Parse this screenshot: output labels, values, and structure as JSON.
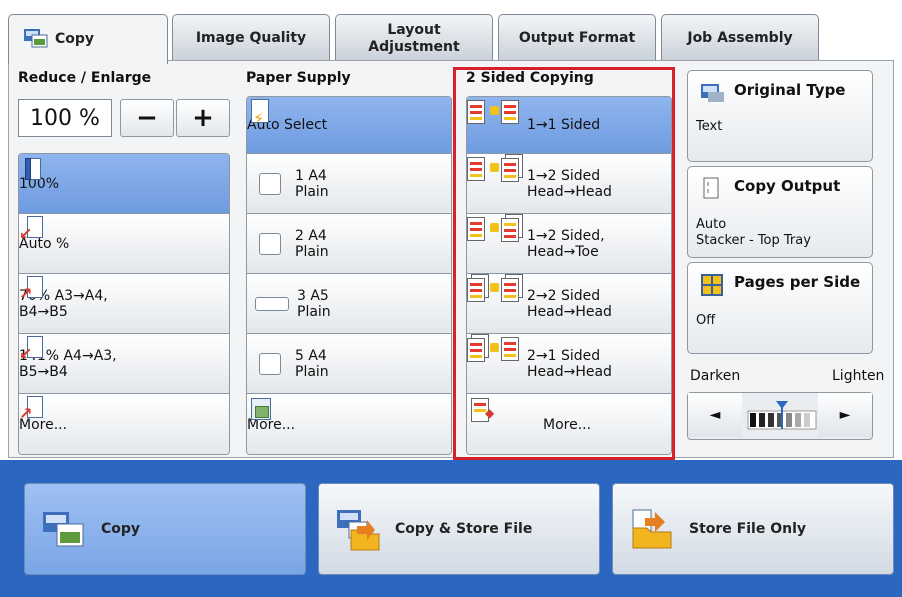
{
  "tabs": [
    {
      "label": "Copy",
      "active": true
    },
    {
      "label": "Image Quality"
    },
    {
      "label": "Layout Adjustment",
      "line1": "Layout",
      "line2": "Adjustment"
    },
    {
      "label": "Output Format"
    },
    {
      "label": "Job Assembly"
    }
  ],
  "reduce_enlarge": {
    "title": "Reduce / Enlarge",
    "value": "100 %",
    "minus": "−",
    "plus": "+",
    "options": [
      {
        "label": "100%",
        "selected": true
      },
      {
        "label": "Auto %"
      },
      {
        "label_line1": "70% A3→A4,",
        "label_line2": "B4→B5"
      },
      {
        "label_line1": "141% A4→A3,",
        "label_line2": "B5→B4"
      },
      {
        "label": "More..."
      }
    ]
  },
  "paper_supply": {
    "title": "Paper Supply",
    "options": [
      {
        "label": "Auto Select",
        "selected": true
      },
      {
        "line1": "1 A4",
        "line2": "Plain"
      },
      {
        "line1": "2 A4",
        "line2": "Plain"
      },
      {
        "line1": "3 A5",
        "line2": "Plain"
      },
      {
        "line1": "5 A4",
        "line2": "Plain"
      },
      {
        "label": "More..."
      }
    ]
  },
  "two_sided": {
    "title": "2 Sided Copying",
    "options": [
      {
        "line1": "1→1 Sided",
        "line2": "",
        "selected": true
      },
      {
        "line1": "1→2 Sided",
        "line2": "Head→Head"
      },
      {
        "line1": "1→2 Sided,",
        "line2": "Head→Toe"
      },
      {
        "line1": "2→2 Sided",
        "line2": "Head→Head"
      },
      {
        "line1": "2→1 Sided",
        "line2": "Head→Head"
      },
      {
        "line1": "More...",
        "line2": ""
      }
    ]
  },
  "original_type": {
    "title": "Original Type",
    "value": "Text"
  },
  "copy_output": {
    "title": "Copy Output",
    "value_line1": "Auto",
    "value_line2": "Stacker - Top Tray"
  },
  "pages_per_side": {
    "title": "Pages per Side",
    "value": "Off"
  },
  "density": {
    "darken": "Darken",
    "lighten": "Lighten",
    "left": "◄",
    "right": "►",
    "level": 0.5
  },
  "bottom": [
    {
      "label": "Copy",
      "active": true
    },
    {
      "label": "Copy & Store File"
    },
    {
      "label": "Store File Only"
    }
  ]
}
